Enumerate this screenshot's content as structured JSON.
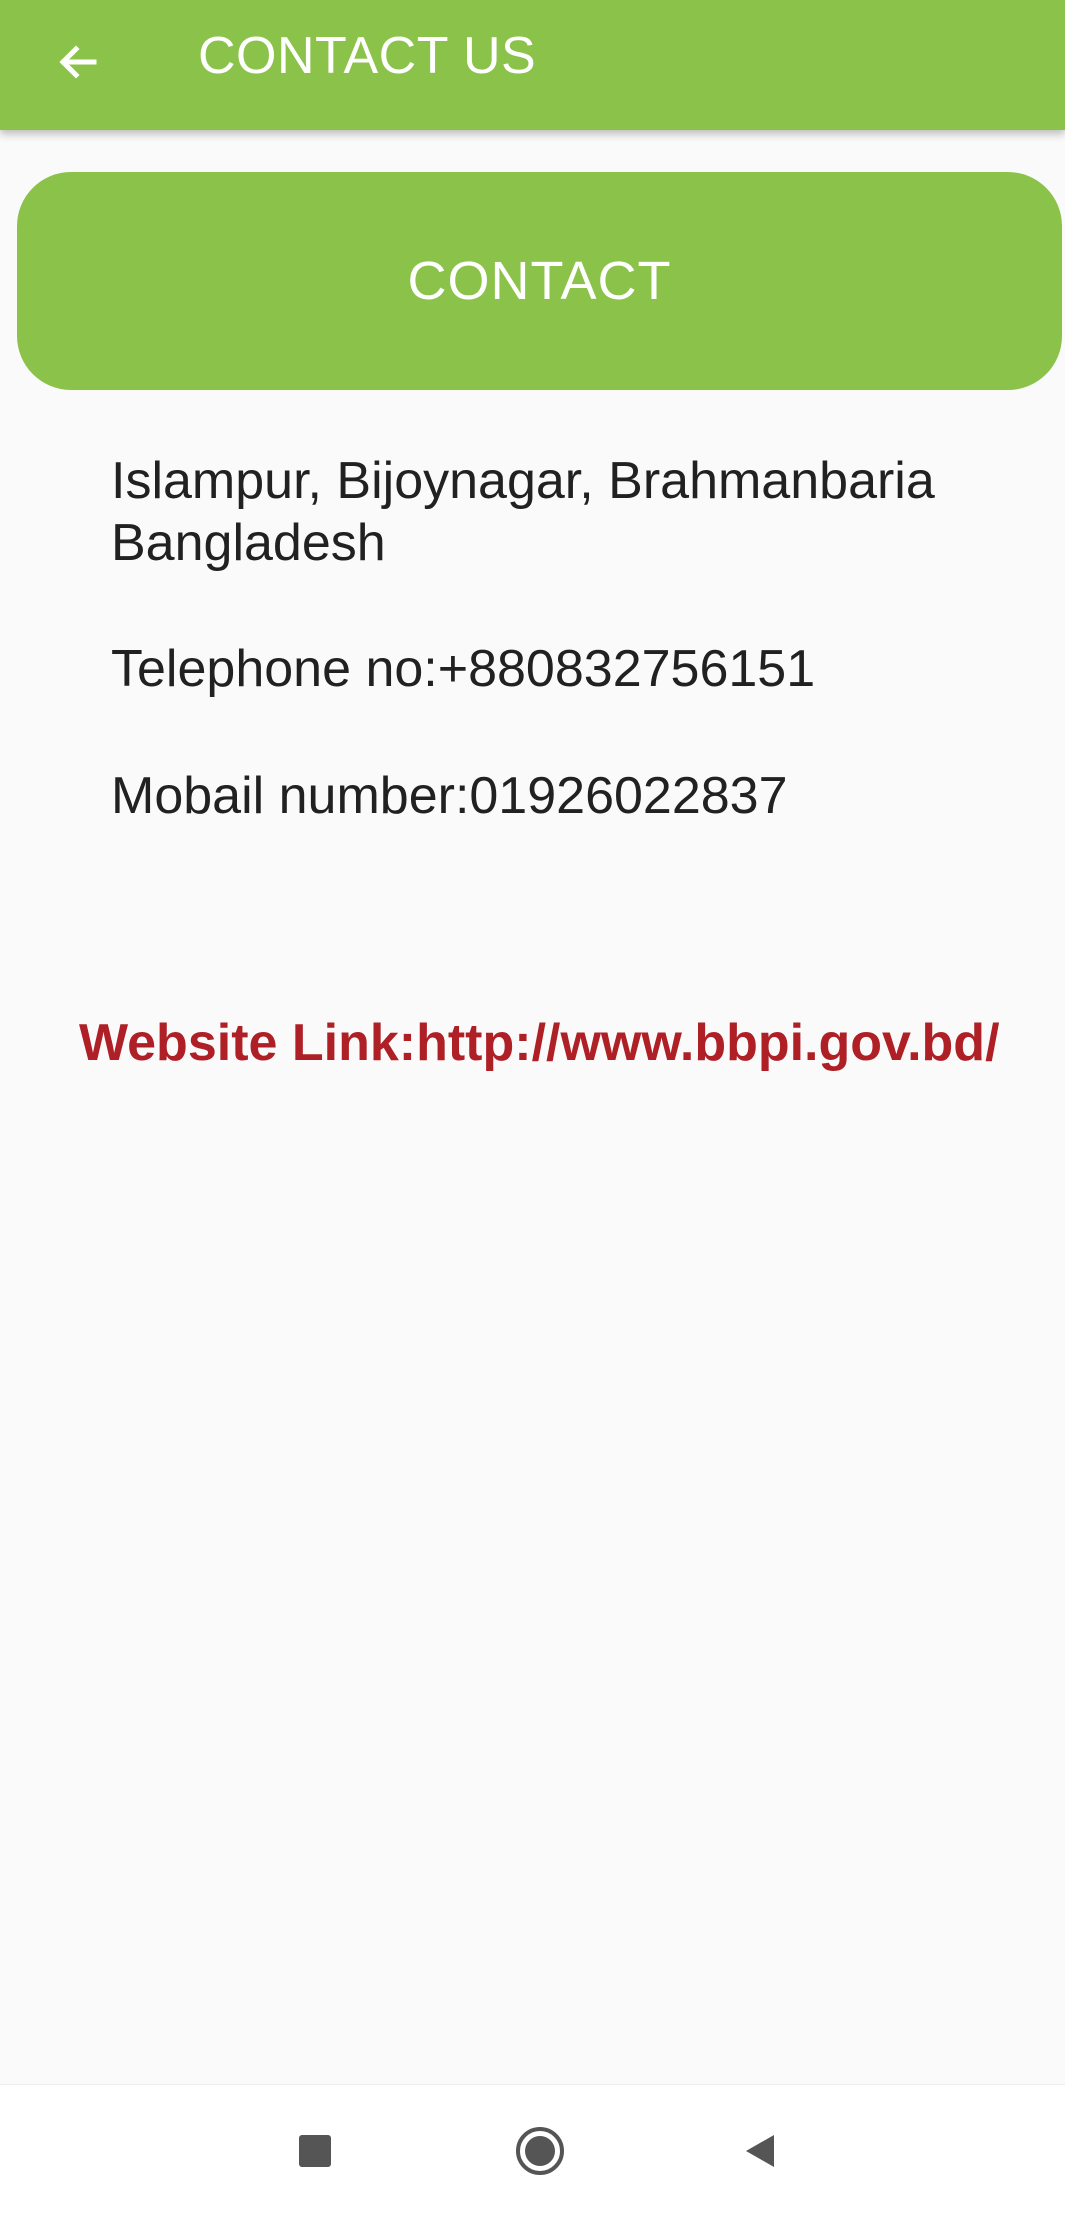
{
  "app_bar": {
    "title": "CONTACT US",
    "background_color": "#8bc34a",
    "back_icon": "arrow-left-icon"
  },
  "contact_header": {
    "label": "CONTACT",
    "background_color": "#8bc34a"
  },
  "contact_info": {
    "address_line1": "Islampur, Bijoynagar, Brahmanbaria",
    "address_line2": "Bangladesh",
    "telephone": "Telephone no:+880832756151",
    "mobile": "Mobail number:01926022837"
  },
  "website": {
    "text": "Website Link:http://www.bbpi.gov.bd/",
    "color": "#ae1f26"
  },
  "nav_bar": {
    "icons": [
      "square-recents-icon",
      "circle-home-icon",
      "triangle-back-icon"
    ]
  }
}
